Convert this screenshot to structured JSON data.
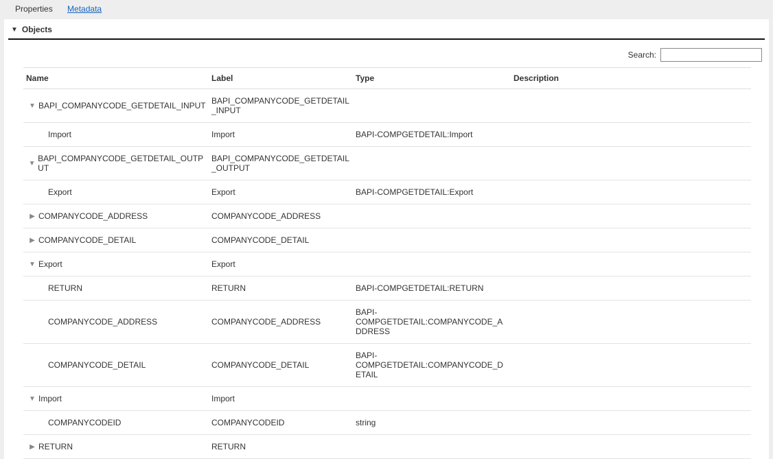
{
  "tabs": {
    "properties": "Properties",
    "metadata": "Metadata"
  },
  "section": {
    "title": "Objects"
  },
  "search": {
    "label": "Search:",
    "value": ""
  },
  "columns": {
    "name": "Name",
    "label": "Label",
    "type": "Type",
    "desc": "Description"
  },
  "rows": [
    {
      "indent": 0,
      "toggle": "down",
      "name": "BAPI_COMPANYCODE_GETDETAIL_INPUT",
      "label": "BAPI_COMPANYCODE_GETDETAIL_INPUT",
      "type": "",
      "desc": ""
    },
    {
      "indent": 1,
      "toggle": "",
      "name": "Import",
      "label": "Import",
      "type": "BAPI-COMPGETDETAIL:Import",
      "desc": ""
    },
    {
      "indent": 0,
      "toggle": "down",
      "name": "BAPI_COMPANYCODE_GETDETAIL_OUTPUT",
      "label": "BAPI_COMPANYCODE_GETDETAIL_OUTPUT",
      "type": "",
      "desc": ""
    },
    {
      "indent": 1,
      "toggle": "",
      "name": "Export",
      "label": "Export",
      "type": "BAPI-COMPGETDETAIL:Export",
      "desc": ""
    },
    {
      "indent": 0,
      "toggle": "right",
      "name": "COMPANYCODE_ADDRESS",
      "label": "COMPANYCODE_ADDRESS",
      "type": "",
      "desc": ""
    },
    {
      "indent": 0,
      "toggle": "right",
      "name": "COMPANYCODE_DETAIL",
      "label": "COMPANYCODE_DETAIL",
      "type": "",
      "desc": ""
    },
    {
      "indent": 0,
      "toggle": "down",
      "name": "Export",
      "label": "Export",
      "type": "",
      "desc": ""
    },
    {
      "indent": 1,
      "toggle": "",
      "name": "RETURN",
      "label": "RETURN",
      "type": "BAPI-COMPGETDETAIL:RETURN",
      "desc": ""
    },
    {
      "indent": 1,
      "toggle": "",
      "name": "COMPANYCODE_ADDRESS",
      "label": "COMPANYCODE_ADDRESS",
      "type": "BAPI-COMPGETDETAIL:COMPANYCODE_ADDRESS",
      "desc": ""
    },
    {
      "indent": 1,
      "toggle": "",
      "name": "COMPANYCODE_DETAIL",
      "label": "COMPANYCODE_DETAIL",
      "type": "BAPI-COMPGETDETAIL:COMPANYCODE_DETAIL",
      "desc": ""
    },
    {
      "indent": 0,
      "toggle": "down",
      "name": "Import",
      "label": "Import",
      "type": "",
      "desc": ""
    },
    {
      "indent": 1,
      "toggle": "",
      "name": "COMPANYCODEID",
      "label": "COMPANYCODEID",
      "type": "string",
      "desc": ""
    },
    {
      "indent": 0,
      "toggle": "right",
      "name": "RETURN",
      "label": "RETURN",
      "type": "",
      "desc": ""
    }
  ]
}
